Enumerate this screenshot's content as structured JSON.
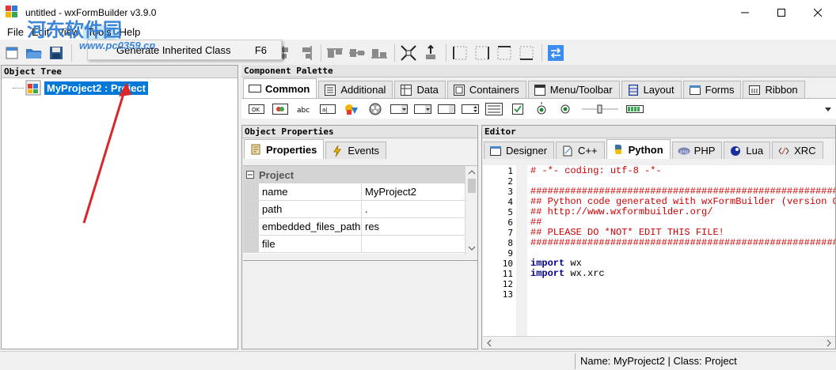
{
  "window": {
    "title": "untitled - wxFormBuilder v3.9.0"
  },
  "menu": {
    "items": [
      "File",
      "Edit",
      "View",
      "Tools",
      "Help"
    ]
  },
  "tools_menu": {
    "item_label": "Generate Inherited Class",
    "item_shortcut": "F6"
  },
  "watermark": {
    "line1": "河东软件园",
    "line2": "www.pc0359.cn"
  },
  "object_tree": {
    "header": "Object Tree",
    "root_label": "MyProject2 : Project"
  },
  "component_palette": {
    "header": "Component Palette",
    "tabs": [
      "Common",
      "Additional",
      "Data",
      "Containers",
      "Menu/Toolbar",
      "Layout",
      "Forms",
      "Ribbon"
    ],
    "active_tab": "Common"
  },
  "object_properties": {
    "header": "Object Properties",
    "tabs": [
      "Properties",
      "Events"
    ],
    "category": "Project",
    "rows": [
      {
        "name": "name",
        "value": "MyProject2"
      },
      {
        "name": "path",
        "value": "."
      },
      {
        "name": "embedded_files_path",
        "value": "res"
      },
      {
        "name": "file",
        "value": ""
      }
    ]
  },
  "editor": {
    "header": "Editor",
    "tabs": [
      "Designer",
      "C++",
      "Python",
      "PHP",
      "Lua",
      "XRC"
    ],
    "active_tab": "Python",
    "lines": [
      "# -*- coding: utf-8 -*-",
      "",
      "###########################################################################",
      "## Python code generated with wxFormBuilder (version Oct",
      "## http://www.wxformbuilder.org/",
      "##",
      "## PLEASE DO *NOT* EDIT THIS FILE!",
      "###########################################################################",
      "",
      "import wx",
      "import wx.xrc",
      "",
      ""
    ]
  },
  "status": {
    "text": "Name: MyProject2 | Class: Project"
  },
  "colors": {
    "selection": "#0078d7",
    "code_comment": "#cc0000",
    "keyword": "#00008b",
    "arrow": "#d8282a"
  }
}
